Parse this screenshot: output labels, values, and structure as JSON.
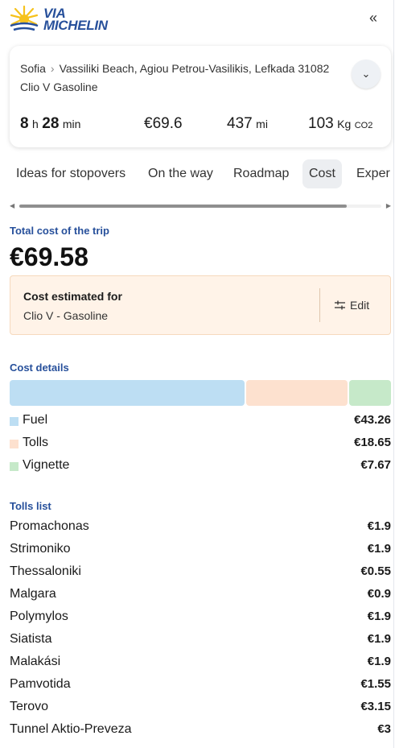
{
  "header": {
    "logo_line1": "VIA",
    "logo_line2": "MICHELIN",
    "collapse_icon": "double-chevron-left-icon"
  },
  "route": {
    "origin": "Sofia",
    "destination": "Vassiliki Beach, Agiou Petrou-Vasilikis, Lefkada 31082",
    "vehicle_model": "Clio V",
    "vehicle_fuel": "Gasoline",
    "duration_hours": "8",
    "duration_hours_unit": "h",
    "duration_minutes": "28",
    "duration_minutes_unit": "min",
    "cost": "€69.6",
    "distance": "437",
    "distance_unit": "mi",
    "co2": "103",
    "co2_unit": "Kg",
    "co2_sub": "CO2"
  },
  "tabs": [
    {
      "label": "Ideas for stopovers"
    },
    {
      "label": "On the way"
    },
    {
      "label": "Roadmap"
    },
    {
      "label": "Cost",
      "active": true
    },
    {
      "label": "Exper"
    }
  ],
  "cost": {
    "total_label": "Total cost of the trip",
    "total_value": "€69.58",
    "estimate_title": "Cost estimated for",
    "estimate_vehicle": "Clio V - Gasoline",
    "edit_label": "Edit",
    "details_label": "Cost details",
    "breakdown": [
      {
        "name": "Fuel",
        "value": "€43.26",
        "amount": 43.26,
        "color": "#bddef3"
      },
      {
        "name": "Tolls",
        "value": "€18.65",
        "amount": 18.65,
        "color": "#fde1cf"
      },
      {
        "name": "Vignette",
        "value": "€7.67",
        "amount": 7.67,
        "color": "#c6e9c9"
      }
    ]
  },
  "tolls": {
    "label": "Tolls list",
    "items": [
      {
        "name": "Promachonas",
        "value": "€1.9"
      },
      {
        "name": "Strimoniko",
        "value": "€1.9"
      },
      {
        "name": "Thessaloniki",
        "value": "€0.55"
      },
      {
        "name": "Malgara",
        "value": "€0.9"
      },
      {
        "name": "Polymylos",
        "value": "€1.9"
      },
      {
        "name": "Siatista",
        "value": "€1.9"
      },
      {
        "name": "Malakási",
        "value": "€1.9"
      },
      {
        "name": "Pamvotida",
        "value": "€1.55"
      },
      {
        "name": "Terovo",
        "value": "€3.15"
      },
      {
        "name": "Tunnel Aktio-Preveza",
        "value": "€3"
      }
    ]
  }
}
